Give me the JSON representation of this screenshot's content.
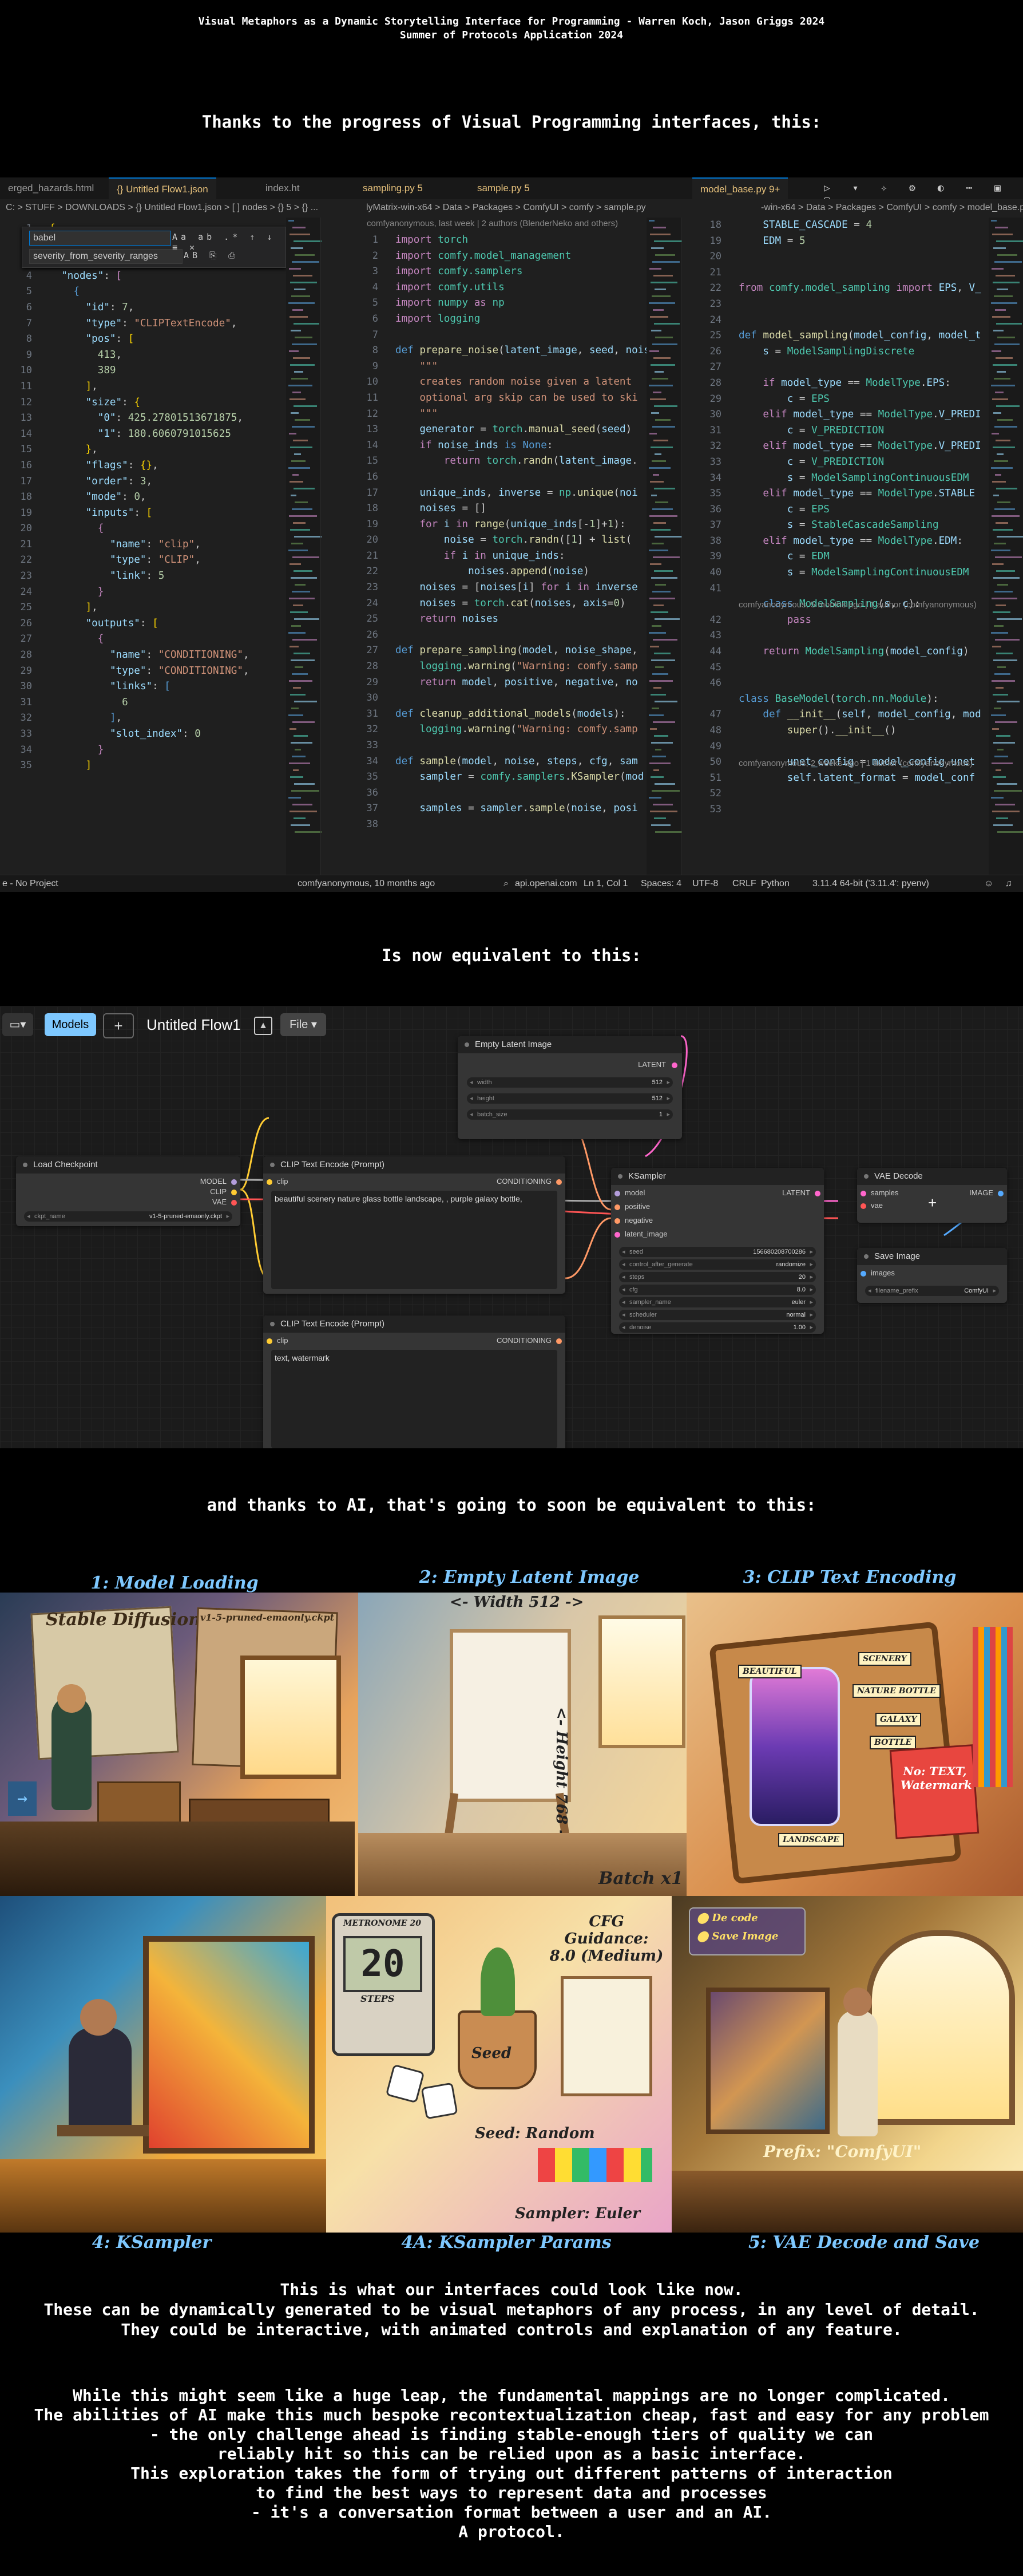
{
  "header": {
    "title_line1": "Visual Metaphors as a Dynamic Storytelling Interface for Programming - Warren Koch, Jason Griggs 2024",
    "title_line2": "Summer of Protocols Application 2024"
  },
  "intro_text": "Thanks to the progress of Visual Programming interfaces, this:",
  "equivalent_text": "Is now equivalent to this:",
  "ai_text": "and thanks to AI, that's going to soon be equivalent to this:",
  "vscode": {
    "tabs": [
      "erged_hazards.html",
      "{} Untitled Flow1.json",
      "index.ht",
      "sampling.py 5",
      "sample.py 5",
      "model_base.py 9+"
    ],
    "crumbs_left": "C: > STUFF > DOWNLOADS > {} Untitled Flow1.json > [ ] nodes > {} 5 > {} ...",
    "crumbs_mid": "lyMatrix-win-x64 > Data > Packages > ComfyUI > comfy > sample.py",
    "crumbs_right": "-win-x64 > Data > Packages > ComfyUI > comfy > model_base.py",
    "find_value": "babel",
    "replace_value": "severity_from_severity_ranges",
    "blame_mid": "comfyanonymous, last week | 2 authors (BlenderNeko and others)",
    "blame_right1": "comfyanonymous, 5 months ago | 1 author (comfyanonymous)",
    "blame_right2": "comfyanonymous, 2 weeks ago | 1 author (comfyanonymous)",
    "status": {
      "left": "e - No Project",
      "git": "comfyanonymous, 10 months ago",
      "api": "api.openai.com",
      "pos": "Ln 1, Col 1",
      "spaces": "Spaces: 4",
      "enc": "UTF-8",
      "eol": "CRLF",
      "lang": "Python",
      "ver": "3.11.4 64-bit ('3.11.4': pyenv)"
    }
  },
  "comfy": {
    "models_button": "Models",
    "plus_button": "+",
    "flow_title": "Untitled Flow1",
    "file_button": "File",
    "nodes": {
      "empty_latent": {
        "title": "Empty Latent Image",
        "output": "LATENT",
        "width_label": "width",
        "width_value": "512",
        "height_label": "height",
        "height_value": "512",
        "batch_label": "batch_size",
        "batch_value": "1"
      },
      "load_checkpoint": {
        "title": "Load Checkpoint",
        "out_model": "MODEL",
        "out_clip": "CLIP",
        "out_vae": "VAE",
        "ckpt_label": "ckpt_name",
        "ckpt_value": "v1-5-pruned-emaonly.ckpt"
      },
      "clip_pos": {
        "title": "CLIP Text Encode (Prompt)",
        "input": "clip",
        "output": "CONDITIONING",
        "text": "beautiful scenery nature glass bottle landscape, , purple galaxy bottle,"
      },
      "clip_neg": {
        "title": "CLIP Text Encode (Prompt)",
        "input": "clip",
        "output": "CONDITIONING",
        "text": "text, watermark"
      },
      "ksampler": {
        "title": "KSampler",
        "in_model": "model",
        "in_positive": "positive",
        "in_negative": "negative",
        "in_latent": "latent_image",
        "output": "LATENT",
        "widgets": [
          {
            "label": "seed",
            "value": "156680208700286"
          },
          {
            "label": "control_after_generate",
            "value": "randomize"
          },
          {
            "label": "steps",
            "value": "20"
          },
          {
            "label": "cfg",
            "value": "8.0"
          },
          {
            "label": "sampler_name",
            "value": "euler"
          },
          {
            "label": "scheduler",
            "value": "normal"
          },
          {
            "label": "denoise",
            "value": "1.00"
          }
        ]
      },
      "vae_decode": {
        "title": "VAE Decode",
        "in_samples": "samples",
        "in_vae": "vae",
        "output": "IMAGE"
      },
      "save_image": {
        "title": "Save Image",
        "input": "images",
        "prefix_label": "filename_prefix",
        "prefix_value": "ComfyUI"
      }
    }
  },
  "panels": {
    "p1": {
      "caption": "1: Model Loading",
      "label": "Stable Diffusion",
      "label2": "v1-5-pruned-emaonly.ckpt"
    },
    "p2": {
      "caption": "2: Empty Latent Image",
      "width_label": "<- Width 512 ->",
      "height_label": "<- Height 768 ->",
      "batch_label": "Batch x1"
    },
    "p3": {
      "caption": "3: CLIP Text Encoding",
      "tag_beautiful": "BEAUTIFUL",
      "tag_scenery": "SCENERY",
      "tag_nature": "NATURE BOTTLE",
      "tag_galaxy": "GALAXY",
      "tag_bottle": "BOTTLE",
      "tag_landscape": "LANDSCAPE",
      "neg_note": "No: TEXT, Watermark"
    },
    "p4": {
      "caption": "4: KSampler"
    },
    "p4a": {
      "caption": "4A: KSampler Params",
      "cfg": "CFG Guidance: 8.0 (Medium)",
      "steps_display": "20",
      "steps_label": "STEPS",
      "seed": "Seed",
      "seed_random": "Seed: Random",
      "sampler": "Sampler: Euler",
      "metronome": "METRONOME 20"
    },
    "p5": {
      "caption": "5: VAE Decode and Save",
      "prefix": "Prefix: \"ComfyUI\"",
      "menu1": "De code",
      "menu2": "Save Image"
    }
  },
  "footer": {
    "p1_lines": [
      "This is what our interfaces could look like now.",
      "These can be dynamically generated to be visual metaphors of any process, in any level of detail.",
      "They could be interactive, with animated controls and explanation of any feature."
    ],
    "p2_lines": [
      "While this might seem like a huge leap, the fundamental mappings are no longer complicated.",
      "The abilities of AI make this much bespoke recontextualization cheap, fast and easy for any problem",
      "- the only challenge ahead is finding stable-enough tiers of quality we can",
      "reliably hit so this can be relied upon as a basic interface.",
      "This exploration takes the form of trying out different patterns of interaction",
      "to find the best ways to represent data and processes",
      "- it's a conversation format between a user and an AI.",
      "A protocol."
    ]
  },
  "colors": {
    "accent": "#0078d4",
    "caption": "#7ec8ff",
    "comfy_active": "#7ec8ff",
    "link_yellow": "#ffcc33",
    "link_pink": "#ff66cc",
    "link_red": "#ff5555"
  }
}
